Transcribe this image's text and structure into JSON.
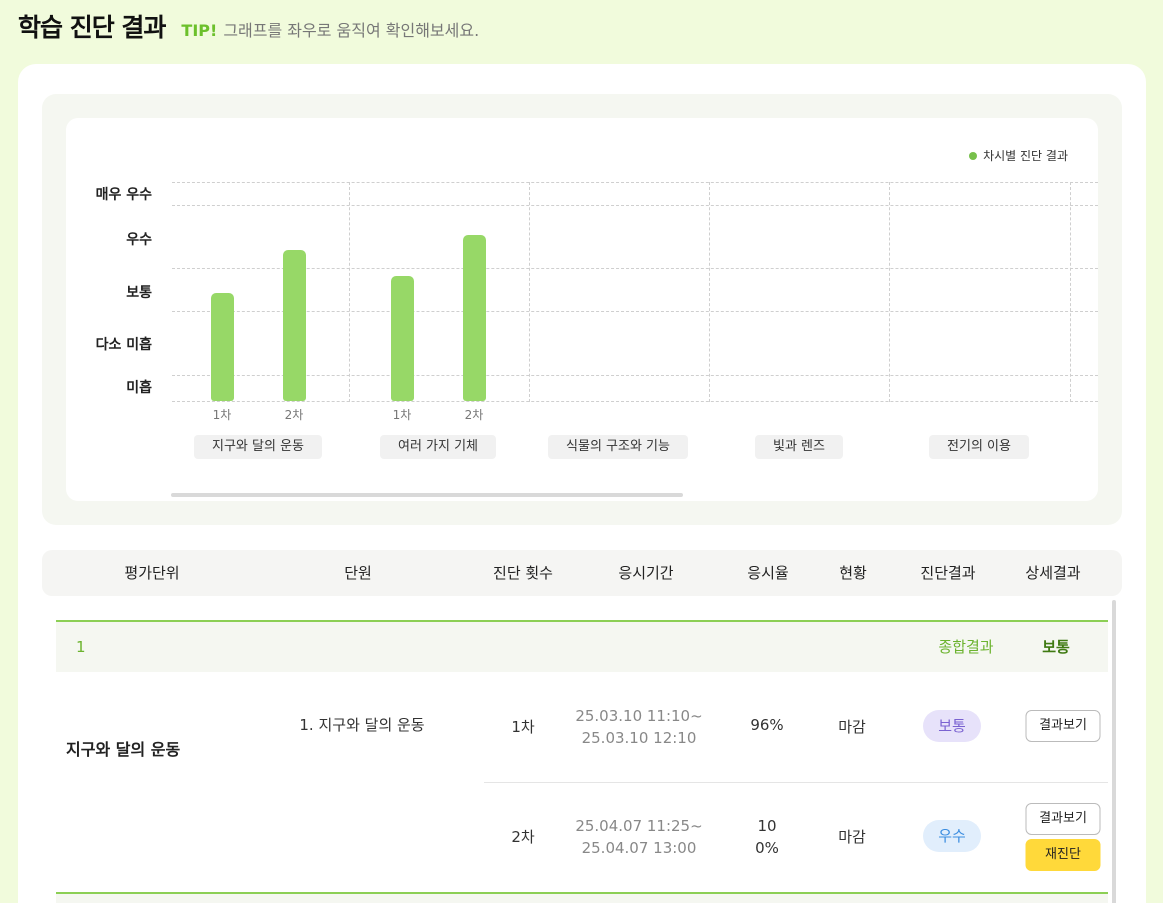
{
  "header": {
    "title": "학습 진단 결과",
    "tip_label": "TIP!",
    "tip_text": "그래프를 좌우로 움직여 확인해보세요."
  },
  "chart_data": {
    "type": "bar",
    "legend": "차시별 진단 결과",
    "levels": [
      "매우 우수",
      "우수",
      "보통",
      "다소 미흡",
      "미흡"
    ],
    "categories": [
      "지구와 달의 운동",
      "여러 가지 기체",
      "식물의 구조와 기능",
      "빛과 렌즈",
      "전기의 이용"
    ],
    "series": [
      {
        "bars": [
          {
            "category": "지구와 달의 운동",
            "label": "1차",
            "level": "보통",
            "score": 2.55
          },
          {
            "category": "지구와 달의 운동",
            "label": "2차",
            "level": "우수",
            "score": 3.55
          },
          {
            "category": "여러 가지 기체",
            "label": "1차",
            "level": "보통",
            "score": 2.95
          },
          {
            "category": "여러 가지 기체",
            "label": "2차",
            "level": "우수",
            "score": 3.9
          }
        ]
      }
    ],
    "ylim": [
      0,
      5
    ],
    "grid": true,
    "legend_position": "top-right",
    "color": "#97d867"
  },
  "table": {
    "columns": [
      "평가단위",
      "단원",
      "진단 횟수",
      "응시기간",
      "응시율",
      "현황",
      "진단결과",
      "상세결과"
    ],
    "group": {
      "number": "1",
      "total_label": "종합결과",
      "total_value": "보통",
      "unit_name": "지구와 달의 운동",
      "chapter": "1. 지구와 달의 운동",
      "rows": [
        {
          "round": "1차",
          "period_start": "25.03.10 11:10~",
          "period_end": "25.03.10 12:10",
          "rate_line1": "96%",
          "rate_line2": "",
          "status": "마감",
          "result": "보통",
          "detail_button": "결과보기",
          "retry_button": ""
        },
        {
          "round": "2차",
          "period_start": "25.04.07 11:25~",
          "period_end": "25.04.07 13:00",
          "rate_line1": "10",
          "rate_line2": "0%",
          "status": "마감",
          "result": "우수",
          "detail_button": "결과보기",
          "retry_button": "재진단"
        }
      ]
    }
  },
  "colors": {
    "accent_green": "#6cc02b",
    "bar_green": "#97d867",
    "badge_normal_bg": "#e7e2fa",
    "badge_good_bg": "#e1eefc",
    "retry_yellow": "#ffd93a"
  }
}
